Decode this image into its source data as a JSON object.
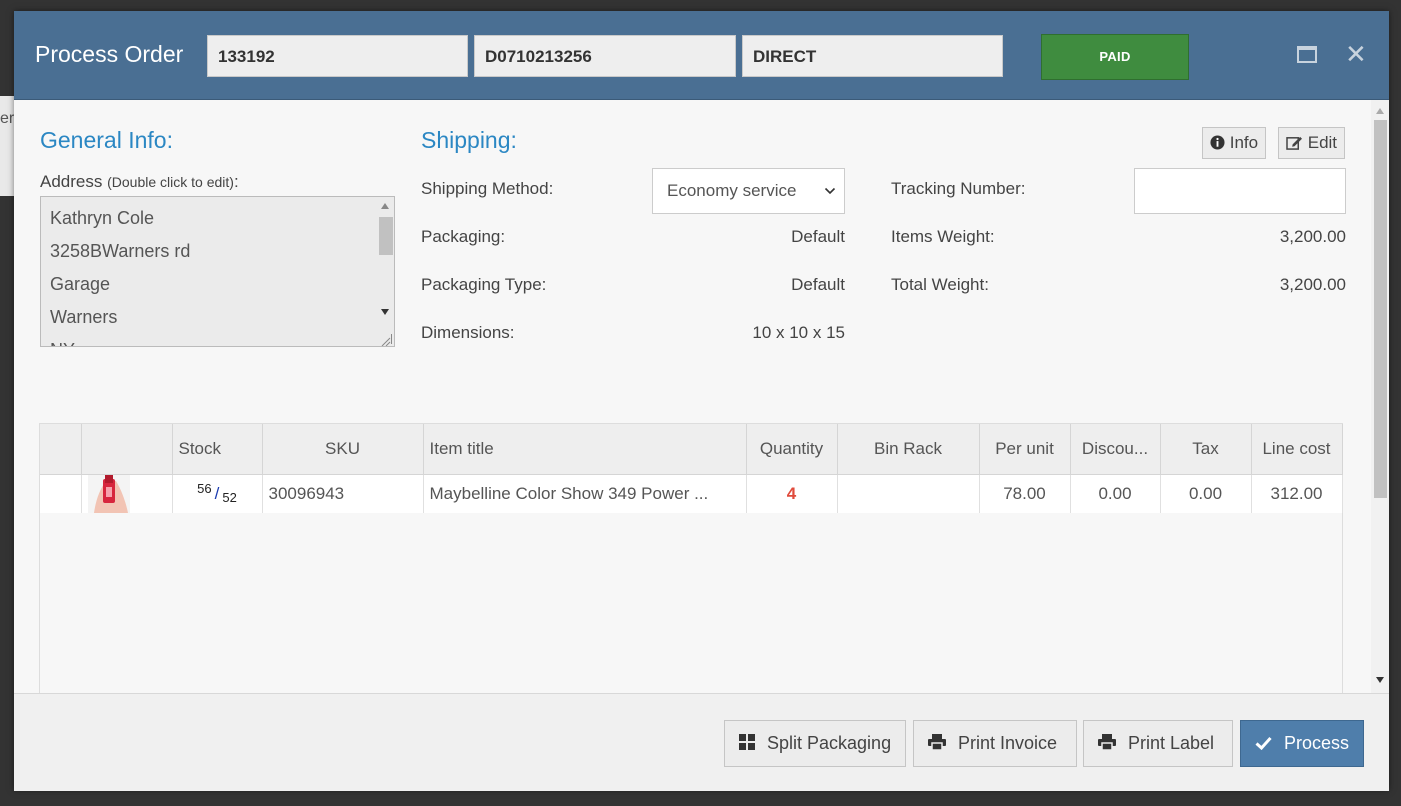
{
  "background": {
    "partial_text": "er"
  },
  "header": {
    "title": "Process Order",
    "order_id": "133192",
    "reference": "D0710213256",
    "channel": "DIRECT",
    "status_badge": "PAID",
    "colors": {
      "header_bg": "#4a6f93",
      "paid_bg": "#3f8c3f"
    }
  },
  "general": {
    "title": "General Info:",
    "address_label": "Address",
    "address_hint": "(Double click to edit)",
    "address_suffix": ":",
    "address_lines": [
      "Kathryn Cole",
      "3258BWarners rd",
      "Garage",
      "Warners",
      "NY"
    ]
  },
  "shipping": {
    "title": "Shipping:",
    "info_button": "Info",
    "edit_button": "Edit",
    "method_label": "Shipping Method:",
    "method_value": "Economy service",
    "packaging_label": "Packaging:",
    "packaging_value": "Default",
    "packaging_type_label": "Packaging Type:",
    "packaging_type_value": "Default",
    "dimensions_label": "Dimensions:",
    "dimensions_value": "10 x 10 x 15",
    "tracking_label": "Tracking Number:",
    "tracking_value": "",
    "items_weight_label": "Items Weight:",
    "items_weight_value": "3,200.00",
    "total_weight_label": "Total Weight:",
    "total_weight_value": "3,200.00"
  },
  "items_table": {
    "columns": [
      "",
      "",
      "Stock",
      "SKU",
      "Item title",
      "Quantity",
      "Bin Rack",
      "Per unit",
      "Discou...",
      "Tax",
      "Line cost"
    ],
    "rows": [
      {
        "stock_available": "56",
        "stock_total": "52",
        "sku": "30096943",
        "title": "Maybelline Color Show 349 Power ...",
        "quantity": "4",
        "bin_rack": "",
        "per_unit": "78.00",
        "discount": "0.00",
        "tax": "0.00",
        "line_cost": "312.00"
      }
    ]
  },
  "footer": {
    "split_packaging": "Split Packaging",
    "print_invoice": "Print Invoice",
    "print_label": "Print Label",
    "process": "Process"
  },
  "icons": [
    "maximize-icon",
    "close-icon",
    "info-icon",
    "edit-icon",
    "grid-icon",
    "printer-icon",
    "check-icon"
  ]
}
